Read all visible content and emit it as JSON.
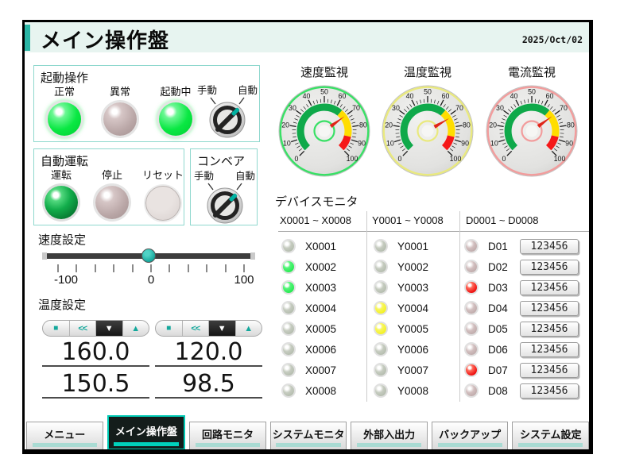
{
  "title": "メイン操作盤",
  "date": "2025/Oct/02",
  "panels": {
    "start_op": {
      "label": "起動操作",
      "lamps": [
        {
          "label": "正常",
          "state": "green"
        },
        {
          "label": "異常",
          "state": "off"
        },
        {
          "label": "起動中",
          "state": "green"
        }
      ],
      "selector": {
        "left": "手動",
        "right": "自動",
        "position": "自動"
      }
    },
    "auto_run": {
      "label": "自動運転",
      "lamps": [
        {
          "label": "運転",
          "state": "green-dark"
        },
        {
          "label": "停止",
          "state": "off"
        },
        {
          "label": "リセット",
          "state": "flat"
        }
      ]
    },
    "conveyor": {
      "label": "コンベア",
      "selector": {
        "left": "手動",
        "right": "自動",
        "position": "自動"
      }
    },
    "speed": {
      "label": "速度設定",
      "min": -100,
      "max": 100,
      "value": 0,
      "tick_count": 11,
      "tick_labels": [
        "-100",
        "0",
        "100"
      ]
    },
    "temp": {
      "label": "温度設定",
      "spinner": [
        "■",
        "<<",
        "▼",
        "▲"
      ],
      "groups": [
        {
          "set": "160.0",
          "actual": "150.5"
        },
        {
          "set": "120.0",
          "actual": "98.5"
        }
      ]
    }
  },
  "gauges": [
    {
      "title": "速度監視",
      "min": 0,
      "max": 100,
      "value": 70,
      "major_step": 10,
      "minor_step": 2.5,
      "ring": "#38e065",
      "needle": "#e02418",
      "zones": [
        {
          "from": 0,
          "to": 65,
          "color": "#0fa94a"
        },
        {
          "from": 65,
          "to": 88,
          "color": "#ffdd00"
        },
        {
          "from": 88,
          "to": 100,
          "color": "#f51818"
        }
      ]
    },
    {
      "title": "温度監視",
      "min": 0,
      "max": 100,
      "value": 72,
      "major_step": 10,
      "minor_step": 2.5,
      "ring": "#e9e97e",
      "needle": "#e02418",
      "zones": [
        {
          "from": 0,
          "to": 65,
          "color": "#0fa94a"
        },
        {
          "from": 65,
          "to": 88,
          "color": "#ffdd00"
        },
        {
          "from": 88,
          "to": 100,
          "color": "#f51818"
        }
      ]
    },
    {
      "title": "電流監視",
      "min": 0,
      "max": 100,
      "value": 70,
      "major_step": 10,
      "minor_step": 2.5,
      "ring": "#f29c9c",
      "needle": "#e02418",
      "zones": [
        {
          "from": 0,
          "to": 65,
          "color": "#0fa94a"
        },
        {
          "from": 65,
          "to": 88,
          "color": "#ffdd00"
        },
        {
          "from": 88,
          "to": 100,
          "color": "#f51818"
        }
      ]
    }
  ],
  "device_monitor": {
    "title": "デバイスモニタ",
    "columns": [
      {
        "header": "X0001 ~ X0008",
        "on_color": "green",
        "off_style": "xy",
        "has_value": false,
        "rows": [
          {
            "label": "X0001",
            "on": false
          },
          {
            "label": "X0002",
            "on": true
          },
          {
            "label": "X0003",
            "on": true
          },
          {
            "label": "X0004",
            "on": false
          },
          {
            "label": "X0005",
            "on": false
          },
          {
            "label": "X0006",
            "on": false
          },
          {
            "label": "X0007",
            "on": false
          },
          {
            "label": "X0008",
            "on": false
          }
        ]
      },
      {
        "header": "Y0001 ~ Y0008",
        "on_color": "yellow",
        "off_style": "xy",
        "has_value": false,
        "rows": [
          {
            "label": "Y0001",
            "on": false
          },
          {
            "label": "Y0002",
            "on": false
          },
          {
            "label": "Y0003",
            "on": false
          },
          {
            "label": "Y0004",
            "on": true
          },
          {
            "label": "Y0005",
            "on": true
          },
          {
            "label": "Y0006",
            "on": false
          },
          {
            "label": "Y0007",
            "on": false
          },
          {
            "label": "Y0008",
            "on": false
          }
        ]
      },
      {
        "header": "D0001 ~ D0008",
        "on_color": "red",
        "off_style": "d",
        "has_value": true,
        "rows": [
          {
            "label": "D01",
            "on": false,
            "value": "123456"
          },
          {
            "label": "D02",
            "on": false,
            "value": "123456"
          },
          {
            "label": "D03",
            "on": true,
            "value": "123456"
          },
          {
            "label": "D04",
            "on": false,
            "value": "123456"
          },
          {
            "label": "D05",
            "on": false,
            "value": "123456"
          },
          {
            "label": "D06",
            "on": false,
            "value": "123456"
          },
          {
            "label": "D07",
            "on": true,
            "value": "123456"
          },
          {
            "label": "D08",
            "on": false,
            "value": "123456"
          }
        ]
      }
    ]
  },
  "tabs": [
    {
      "label": "メニュー",
      "active": false
    },
    {
      "label": "メイン操作盤",
      "active": true
    },
    {
      "label": "回路モニタ",
      "active": false
    },
    {
      "label": "システムモニタ",
      "active": false
    },
    {
      "label": "外部入出力",
      "active": false
    },
    {
      "label": "バックアップ",
      "active": false
    },
    {
      "label": "システム設定",
      "active": false
    }
  ]
}
